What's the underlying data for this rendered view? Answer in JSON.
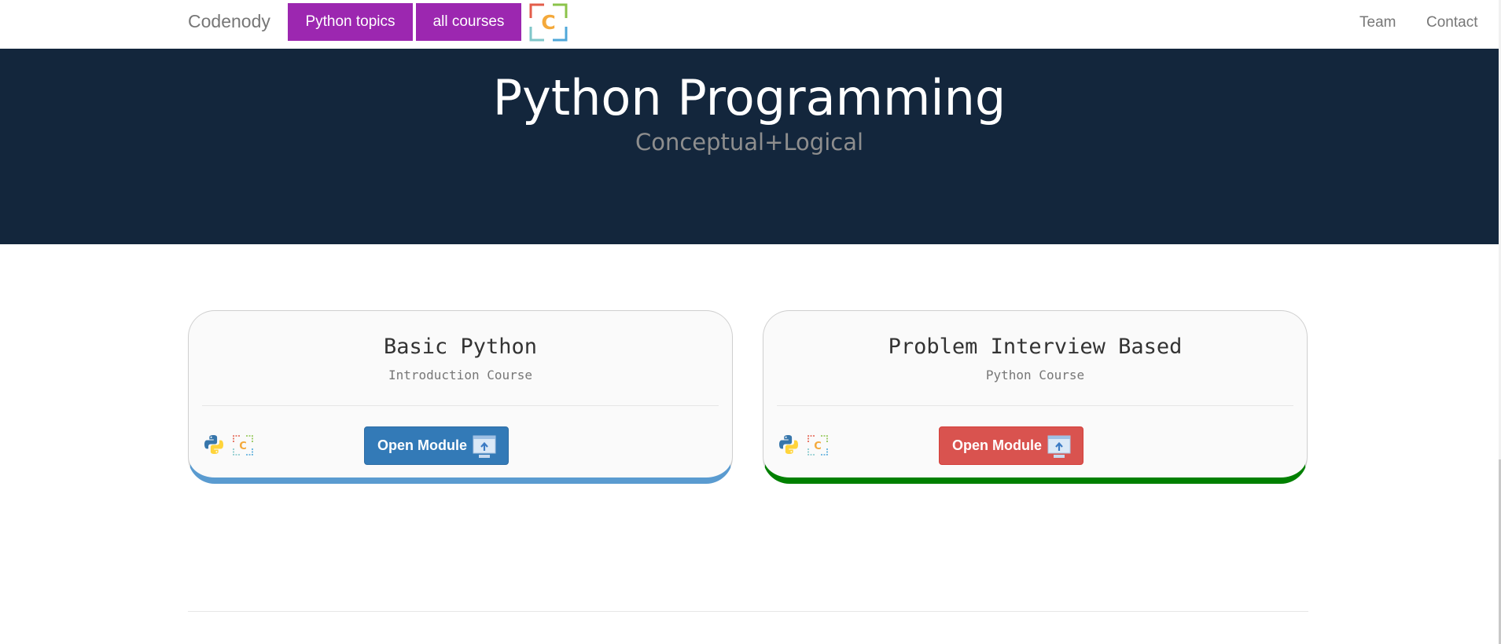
{
  "nav": {
    "brand": "Codenody",
    "buttons": [
      "Python topics",
      "all courses"
    ],
    "links": [
      "Team",
      "Contact"
    ],
    "button_color": "#9c27b0"
  },
  "hero": {
    "title": "Python Programming",
    "subtitle": "Conceptual+Logical",
    "background": "#13263c"
  },
  "cards": [
    {
      "title": "Basic Python",
      "subtitle": "Introduction Course",
      "button_label": "Open Module",
      "button_color": "#337ab7",
      "accent_color": "#5a9bd0",
      "icons": [
        "python-logo-icon",
        "codenody-logo-icon",
        "module-upload-icon"
      ]
    },
    {
      "title": "Problem Interview Based",
      "subtitle": "Python Course",
      "button_label": "Open Module",
      "button_color": "#d9534f",
      "accent_color": "#008000",
      "icons": [
        "python-logo-icon",
        "codenody-logo-icon",
        "module-upload-icon"
      ]
    }
  ]
}
